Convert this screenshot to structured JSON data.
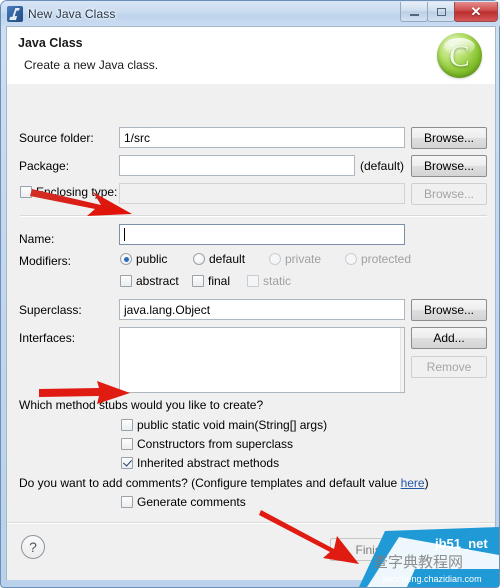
{
  "window": {
    "title": "New Java Class",
    "app_icon": "java-class-icon",
    "buttons": {
      "minimize": "minimize-icon",
      "maximize": "maximize-icon",
      "close": "✕"
    }
  },
  "banner": {
    "title": "Java Class",
    "subtitle": "Create a new Java class.",
    "icon_letter": "C",
    "icon_name": "java-class-wizard-icon"
  },
  "form": {
    "source_folder": {
      "label": "Source folder:",
      "value": "1/src",
      "button": "Browse..."
    },
    "package": {
      "label": "Package:",
      "value": "",
      "suffix": "(default)",
      "button": "Browse..."
    },
    "enclosing_type": {
      "label": "Enclosing type:",
      "value": "",
      "checked": false,
      "enabled": false,
      "button": "Browse..."
    },
    "name": {
      "label": "Name:",
      "value": ""
    },
    "modifiers": {
      "label": "Modifiers:",
      "radios": [
        {
          "label": "public",
          "selected": true,
          "enabled": true
        },
        {
          "label": "default",
          "selected": false,
          "enabled": true
        },
        {
          "label": "private",
          "selected": false,
          "enabled": false
        },
        {
          "label": "protected",
          "selected": false,
          "enabled": false
        }
      ],
      "checkboxes": [
        {
          "label": "abstract",
          "checked": false,
          "enabled": true
        },
        {
          "label": "final",
          "checked": false,
          "enabled": true
        },
        {
          "label": "static",
          "checked": false,
          "enabled": false
        }
      ]
    },
    "superclass": {
      "label": "Superclass:",
      "value": "java.lang.Object",
      "button": "Browse..."
    },
    "interfaces": {
      "label": "Interfaces:",
      "items": [],
      "add_button": "Add...",
      "remove_button": "Remove",
      "remove_enabled": false
    },
    "method_stubs": {
      "question": "Which method stubs would you like to create?",
      "options": [
        {
          "label": "public static void main(String[] args)",
          "checked": false
        },
        {
          "label": "Constructors from superclass",
          "checked": false
        },
        {
          "label": "Inherited abstract methods",
          "checked": true
        }
      ]
    },
    "comments": {
      "question_prefix": "Do you want to add comments? (Configure templates and default value ",
      "link": "here",
      "question_suffix": ")",
      "option": {
        "label": "Generate comments",
        "checked": false
      }
    }
  },
  "footer": {
    "help": "?",
    "finish": "Finish"
  },
  "annotations": {
    "arrow_color": "#e01b12",
    "arrows": [
      {
        "name": "arrow-to-name-field"
      },
      {
        "name": "arrow-to-main-method-checkbox"
      },
      {
        "name": "arrow-to-finish-button"
      }
    ]
  },
  "watermark": {
    "site": "jb51_net",
    "cn_text": "查字典教程网",
    "url": "jiaocheng.chazidian.com"
  }
}
